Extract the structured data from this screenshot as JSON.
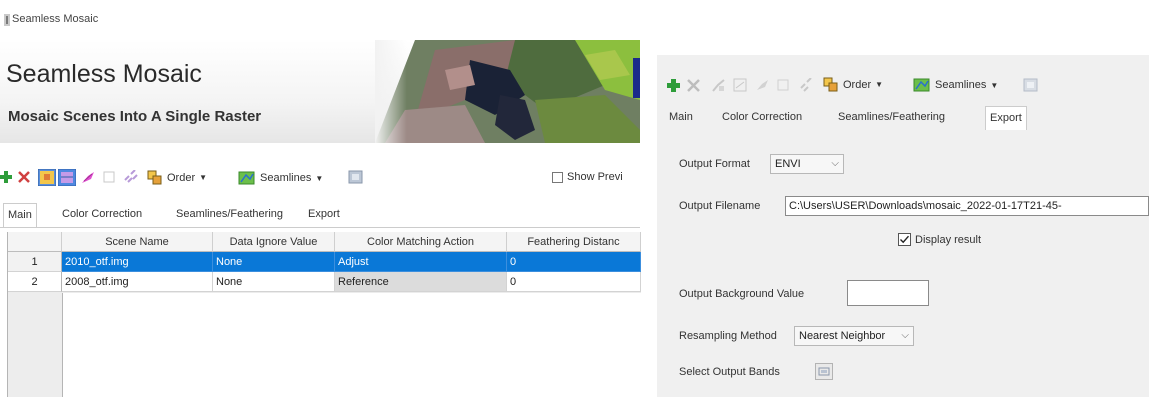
{
  "window": {
    "title": "Seamless Mosaic"
  },
  "banner": {
    "title": "Seamless Mosaic",
    "subtitle": "Mosaic Scenes Into A Single Raster",
    "image": "satellite-thumbnail"
  },
  "toolbar": {
    "order_label": "Order",
    "seamlines_label": "Seamlines",
    "show_preview_label": "Show Previ",
    "icons": [
      "add-icon",
      "remove-icon",
      "color-correct-icon",
      "seamline-edit-icon",
      "feather-icon",
      "footprint-icon",
      "link-icon",
      "order-icon",
      "seamlines-icon",
      "export-icon"
    ]
  },
  "left_tabs": [
    "Main",
    "Color Correction",
    "Seamlines/Feathering",
    "Export"
  ],
  "scene_table": {
    "columns": [
      "Scene Name",
      "Data Ignore Value",
      "Color Matching Action",
      "Feathering Distanc"
    ],
    "rows": [
      {
        "index": "1",
        "scene_name": "2010_otf.img",
        "ignore": "None",
        "action": "Adjust",
        "feather": "0"
      },
      {
        "index": "2",
        "scene_name": "2008_otf.img",
        "ignore": "None",
        "action": "Reference",
        "feather": "0"
      }
    ]
  },
  "right_tabs": [
    "Main",
    "Color Correction",
    "Seamlines/Feathering",
    "Export"
  ],
  "export": {
    "output_format_label": "Output Format",
    "output_format_value": "ENVI",
    "output_filename_label": "Output Filename",
    "output_filename_value": "C:\\Users\\USER\\Downloads\\mosaic_2022-01-17T21-45-",
    "display_result_label": "Display result",
    "display_result_checked": true,
    "background_label": "Output Background Value",
    "background_value": "",
    "resampling_label": "Resampling Method",
    "resampling_value": "Nearest Neighbor",
    "bands_label": "Select Output Bands"
  },
  "colors": {
    "selection": "#0a78d7",
    "add_green": "#2e9d3a",
    "remove_red": "#d04040"
  }
}
